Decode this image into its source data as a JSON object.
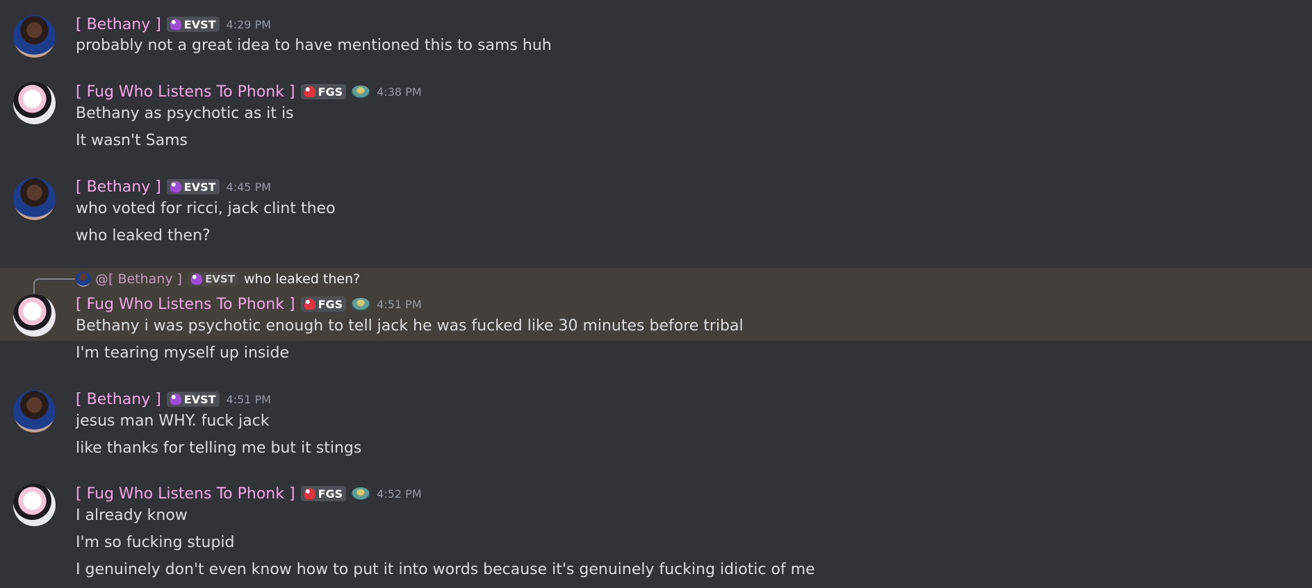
{
  "messages": [
    {
      "author": "[ Bethany ]",
      "tag": "EVST",
      "time": "4:29 PM",
      "lines": [
        "probably not a great idea to have mentioned this to sams huh"
      ]
    },
    {
      "author": "[ Fug Who Listens To Phonk ]",
      "tag": "FGS",
      "time": "4:38 PM",
      "lines": [
        "Bethany as psychotic as it is",
        "It wasn't Sams"
      ]
    },
    {
      "author": "[ Bethany ]",
      "tag": "EVST",
      "time": "4:45 PM",
      "lines": [
        "who voted for ricci, jack clint theo",
        "who leaked then?"
      ]
    },
    {
      "reply": {
        "author": "@[ Bethany ]",
        "tag": "EVST",
        "text": "who leaked then?"
      },
      "author": "[ Fug Who Listens To Phonk ]",
      "tag": "FGS",
      "time": "4:51 PM",
      "lines": [
        "Bethany i was psychotic enough to tell jack he was fucked like 30 minutes before tribal",
        "I'm tearing myself up inside"
      ]
    },
    {
      "author": "[ Bethany ]",
      "tag": "EVST",
      "time": "4:51 PM",
      "lines": [
        "jesus man WHY. fuck jack",
        "like thanks for telling me but it stings"
      ]
    },
    {
      "author": "[ Fug Who Listens To Phonk ]",
      "tag": "FGS",
      "time": "4:52 PM",
      "lines": [
        "I already know",
        "I'm so fucking stupid",
        "I genuinely don't even know how to put it into words because it's genuinely fucking idiotic of me"
      ]
    }
  ],
  "colors": {
    "background": "#313338",
    "username": "#f4a6e6",
    "highlight": "#433f3b"
  }
}
